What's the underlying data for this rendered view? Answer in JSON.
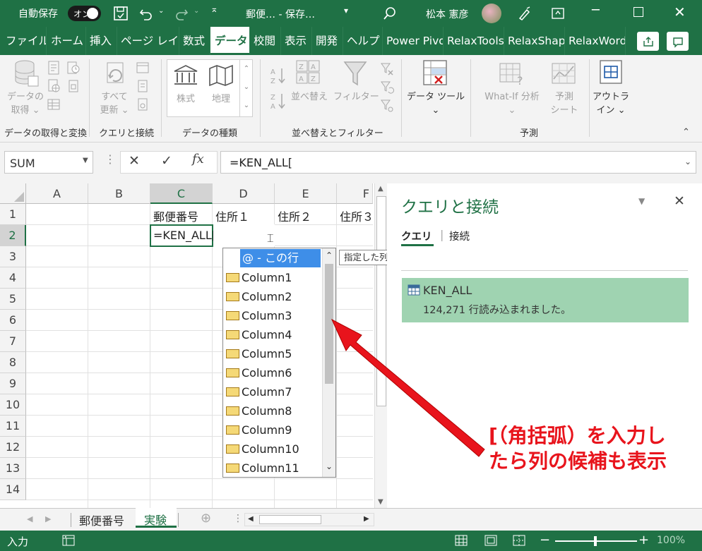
{
  "titlebar": {
    "autosave_label": "自動保存",
    "autosave_toggle": "オン",
    "doc_title": "郵便… - 保存…",
    "user_name": "松本 憲彦"
  },
  "tabs": [
    {
      "label": "ファイル"
    },
    {
      "label": "ホーム"
    },
    {
      "label": "挿入"
    },
    {
      "label": "ページ レイアウト"
    },
    {
      "label": "数式"
    },
    {
      "label": "データ"
    },
    {
      "label": "校閲"
    },
    {
      "label": "表示"
    },
    {
      "label": "開発"
    },
    {
      "label": "ヘルプ"
    },
    {
      "label": "Power Pivot"
    },
    {
      "label": "RelaxTools"
    },
    {
      "label": "RelaxShapes"
    },
    {
      "label": "RelaxWords"
    }
  ],
  "ribbon": {
    "get_data_line1": "データの",
    "get_data_line2": "取得",
    "refresh_line1": "すべて",
    "refresh_line2": "更新",
    "stocks": "株式",
    "geography": "地理",
    "sort": "並べ替え",
    "filter": "フィルター",
    "data_tools_line1": "データ ツール",
    "whatif": "What-If 分析",
    "forecast_line1": "予測",
    "forecast_line2": "シート",
    "outline_line1": "アウトラ",
    "outline_line2": "イン",
    "groups": {
      "get_transform": "データの取得と変換",
      "queries": "クエリと接続",
      "data_types": "データの種類",
      "sort_filter": "並べ替えとフィルター",
      "forecast": "予測"
    }
  },
  "formula_bar": {
    "name_box": "SUM",
    "formula": "=KEN_ALL["
  },
  "grid": {
    "columns": [
      "A",
      "B",
      "C",
      "D",
      "E",
      "F"
    ],
    "rows": [
      "1",
      "2",
      "3",
      "4",
      "5",
      "6",
      "7",
      "8",
      "9",
      "10",
      "11",
      "12",
      "13",
      "14"
    ],
    "c1": "郵便番号",
    "d1": "住所１",
    "e1": "住所２",
    "f1": "住所３",
    "c2": "=KEN_ALL["
  },
  "autocomplete": {
    "items": [
      "@ - この行",
      "Column1",
      "Column2",
      "Column3",
      "Column4",
      "Column5",
      "Column6",
      "Column7",
      "Column8",
      "Column9",
      "Column10",
      "Column11"
    ],
    "tooltip": "指定した列のこの行のみを選択します"
  },
  "panel": {
    "title": "クエリと接続",
    "tab_queries": "クエリ",
    "tab_connections": "接続",
    "query_name": "KEN_ALL",
    "query_status": "124,271 行読み込まれました。"
  },
  "annotation": {
    "line1": "[（角括弧）を入力し",
    "line2": "たら列の候補も表示"
  },
  "sheets": {
    "sheet1": "郵便番号",
    "sheet2": "実験"
  },
  "status": {
    "mode": "入力",
    "zoom": "100%"
  },
  "colors": {
    "excel_green": "#1f7145",
    "annotation_red": "#e8141c",
    "query_card": "#9fd3b1"
  }
}
